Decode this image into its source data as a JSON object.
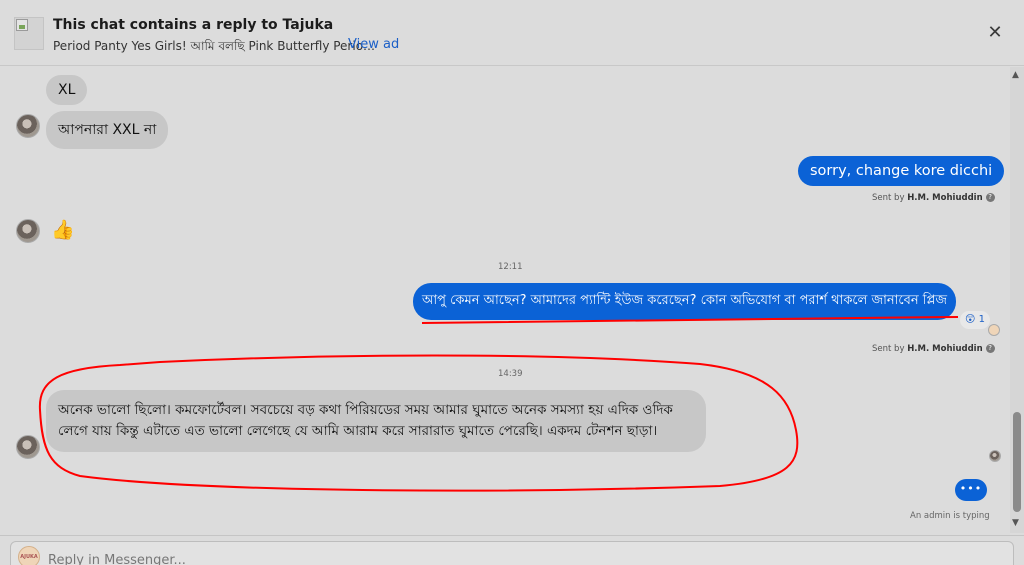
{
  "header": {
    "title": "This chat contains a reply to Tajuka",
    "ad_text": "Period Panty Yes Girls! আমি বলছি Pink Butterfly Perio…",
    "view_ad_label": "View ad",
    "close_symbol": "✕"
  },
  "messages": {
    "xl": "XL",
    "xxl": "আপনারা XXL না",
    "sorry": "sorry, change kore dicchi",
    "like": "👍",
    "question": "আপু কেমন আছেন? আমাদের প্যান্টি ইউজ করেছেন? কোন অভিযোগ বা পরার্শ থাকলে জানাবেন প্লিজ",
    "reaction_emoji": "😲",
    "reaction_count": "1",
    "reply": "অনেক ভালো ছিলো। কমফোর্টেবল। সবচেয়ে বড় কথা পিরিয়ডের সময় আমার ঘুমাতে অনেক সমস্যা হয় এদিক ওদিক লেগে যায় কিন্তু এটাতে এত ভালো লেগেছে যে আমি আরাম করে সারারাত ঘুমাতে পেরেছি। একদম টেনশন ছাড়া।"
  },
  "sent_by": {
    "prefix": "Sent by",
    "name": "H.M. Mohiuddin",
    "help": "?"
  },
  "timestamps": {
    "first": "12:11",
    "second": "14:39"
  },
  "typing": {
    "dots": "•••",
    "label": "An admin is typing"
  },
  "composer": {
    "placeholder": "Reply in Messenger...",
    "avatar_text": "AJUKA"
  },
  "colors": {
    "outgoing_bubble": "#0b62d6",
    "incoming_bubble": "#c7c7c7",
    "annotation_red": "#ff0000",
    "link_blue": "#1b5fc7"
  }
}
